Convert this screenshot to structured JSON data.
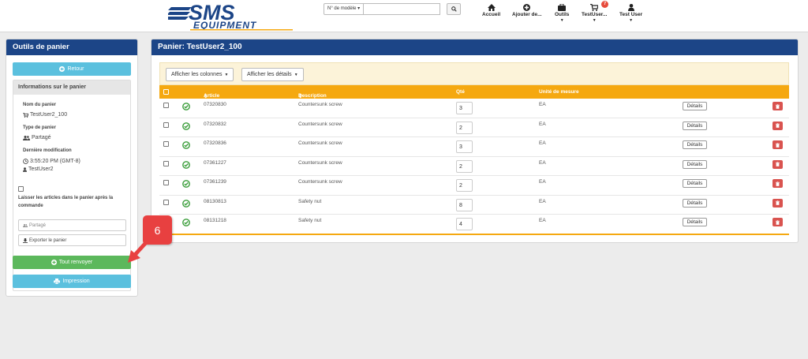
{
  "header": {
    "logo_sms": "SMS",
    "logo_equipment": "EQUIPMENT",
    "model_select": "N° de modèle",
    "search_placeholder": "",
    "nav": [
      {
        "label": "Accueil",
        "icon": "home-icon"
      },
      {
        "label": "Ajouter de...",
        "icon": "plus-circle-icon"
      },
      {
        "label": "Outils",
        "icon": "briefcase-icon"
      },
      {
        "label": "TestUser...",
        "icon": "cart-icon",
        "badge": "7"
      },
      {
        "label": "Test User",
        "icon": "user-icon"
      }
    ]
  },
  "sidebar": {
    "title": "Outils de panier",
    "back_button": "Retour",
    "info_title": "Informations sur le panier",
    "cart_name_label": "Nom du panier",
    "cart_name": "TestUser2_100",
    "cart_type_label": "Type de panier",
    "cart_type": "Partagé",
    "last_modified_label": "Dernière modification",
    "last_modified_time": "3:55:20 PM (GMT-8)",
    "last_modified_user": "TestUser2",
    "keep_items_label": "Laisser les articles dans le panier après la commande",
    "shared_button": "Partagé",
    "export_button": "Exporter le panier",
    "resend_all_button": "Tout renvoyer",
    "print_button": "Impression"
  },
  "main": {
    "title": "Panier: TestUser2_100",
    "show_columns": "Afficher les colonnes",
    "show_details": "Afficher les détails",
    "columns": {
      "article": "Article",
      "description": "Description",
      "qty": "Qté",
      "uom": "Unité de mesure"
    },
    "rows": [
      {
        "article": "07320830",
        "description": "Countersunk screw",
        "qty": "3",
        "uom": "EA",
        "details": "Détails"
      },
      {
        "article": "07320832",
        "description": "Countersunk screw",
        "qty": "2",
        "uom": "EA",
        "details": "Détails"
      },
      {
        "article": "07320836",
        "description": "Countersunk screw",
        "qty": "3",
        "uom": "EA",
        "details": "Détails"
      },
      {
        "article": "07361227",
        "description": "Countersunk screw",
        "qty": "2",
        "uom": "EA",
        "details": "Détails"
      },
      {
        "article": "07361239",
        "description": "Countersunk screw",
        "qty": "2",
        "uom": "EA",
        "details": "Détails"
      },
      {
        "article": "08130813",
        "description": "Safety nut",
        "qty": "8",
        "uom": "EA",
        "details": "Détails"
      },
      {
        "article": "08131218",
        "description": "Safety nut",
        "qty": "4",
        "uom": "EA",
        "details": "Détails"
      }
    ]
  },
  "callout": {
    "number": "6"
  },
  "colors": {
    "navy": "#1c4587",
    "orange": "#f5a810",
    "green": "#5cb85c",
    "cyan": "#5bc0de",
    "red": "#e84040"
  }
}
